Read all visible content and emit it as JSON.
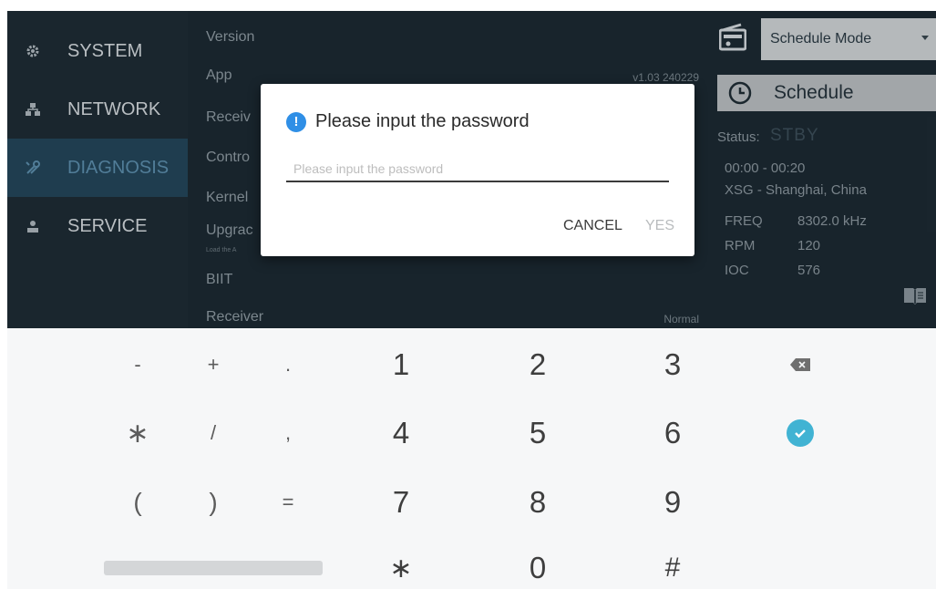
{
  "nav": {
    "items": [
      {
        "label": "SYSTEM",
        "icon": "gear-icon"
      },
      {
        "label": "NETWORK",
        "icon": "network-icon"
      },
      {
        "label": "DIAGNOSIS",
        "icon": "tools-icon"
      },
      {
        "label": "SERVICE",
        "icon": "person-icon"
      }
    ],
    "active": "DIAGNOSIS"
  },
  "info": {
    "version_label": "Version",
    "app_label": "App",
    "app_value": "v1.03 240229",
    "receiver_label": "Receiv",
    "control_label": "Contro",
    "kernel_label": "Kernel",
    "upgrade_label": "Upgrac",
    "upgrade_sub": "Load the A",
    "biit_label": "BIIT",
    "receiver2_label": "Receiver",
    "receiver2_value": "Normal"
  },
  "right": {
    "mode": "Schedule Mode",
    "schedule_label": "Schedule",
    "status_label": "Status:",
    "status_value": "STBY",
    "time_range": "00:00 - 00:20",
    "station": "XSG - Shanghai, China",
    "freq_label": "FREQ",
    "freq_value": "8302.0 kHz",
    "rpm_label": "RPM",
    "rpm_value": "120",
    "ioc_label": "IOC",
    "ioc_value": "576"
  },
  "dialog": {
    "title": "Please input the password",
    "placeholder": "Please input the password",
    "value": "",
    "cancel_label": "CANCEL",
    "yes_label": "YES"
  },
  "keyboard": {
    "row1": [
      "-",
      "+",
      ".",
      "1",
      "2",
      "3"
    ],
    "row2": [
      "∗",
      "/",
      ",",
      "4",
      "5",
      "6"
    ],
    "row3": [
      "(",
      ")",
      "=",
      "7",
      "8",
      "9"
    ],
    "row4": [
      "∗",
      "0",
      "#"
    ]
  },
  "colors": {
    "panel_bg": "#1c2a33",
    "active_nav": "#24465a",
    "accent_blue": "#2f8fe6",
    "enter_teal": "#41b3d3"
  }
}
